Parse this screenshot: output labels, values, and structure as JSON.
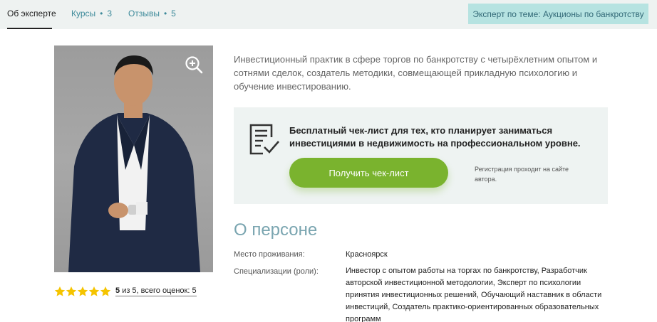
{
  "tabs": [
    {
      "label": "Об эксперте",
      "count": ""
    },
    {
      "label": "Курсы",
      "count": "3"
    },
    {
      "label": "Отзывы",
      "count": "5"
    }
  ],
  "badge": "Эксперт по теме: Аукционы по банкротству",
  "intro": "Инвестиционный практик в сфере торгов по банкротству с четырёхлетним опытом и сотнями сделок, создатель методики, совмещающей прикладную психологию и обучение инвестированию.",
  "promo": {
    "title": "Бесплатный чек-лист для тех, кто планирует заниматься инвестициями в недвижимость на профессиональном уровне.",
    "button": "Получить чек-лист",
    "note": "Регистрация проходит на сайте автора."
  },
  "rating": {
    "stars_filled": 5,
    "stars_total": 5,
    "score": "5",
    "suffix": "из 5, всего оценок: 5"
  },
  "person": {
    "title": "О персоне",
    "rows": [
      {
        "label": "Место проживания:",
        "value": "Красноярск"
      },
      {
        "label": "Специализации (роли):",
        "value": "Инвестор с опытом работы на торгах по банкротству, Разработчик авторской инвестиционной методологии, Эксперт по психологии принятия инвестиционных решений, Обучающий наставник в области инвестиций, Создатель практико-ориентированных образовательных программ"
      }
    ]
  },
  "icons": {
    "zoom": "zoom-in-icon",
    "checklist": "checklist-icon",
    "star": "star-icon"
  },
  "colors": {
    "accent": "#7ab32e",
    "badge_bg": "#b6e3e1",
    "link": "#3d8a9a",
    "person_title": "#7aa5b0",
    "star": "#f5c400"
  }
}
